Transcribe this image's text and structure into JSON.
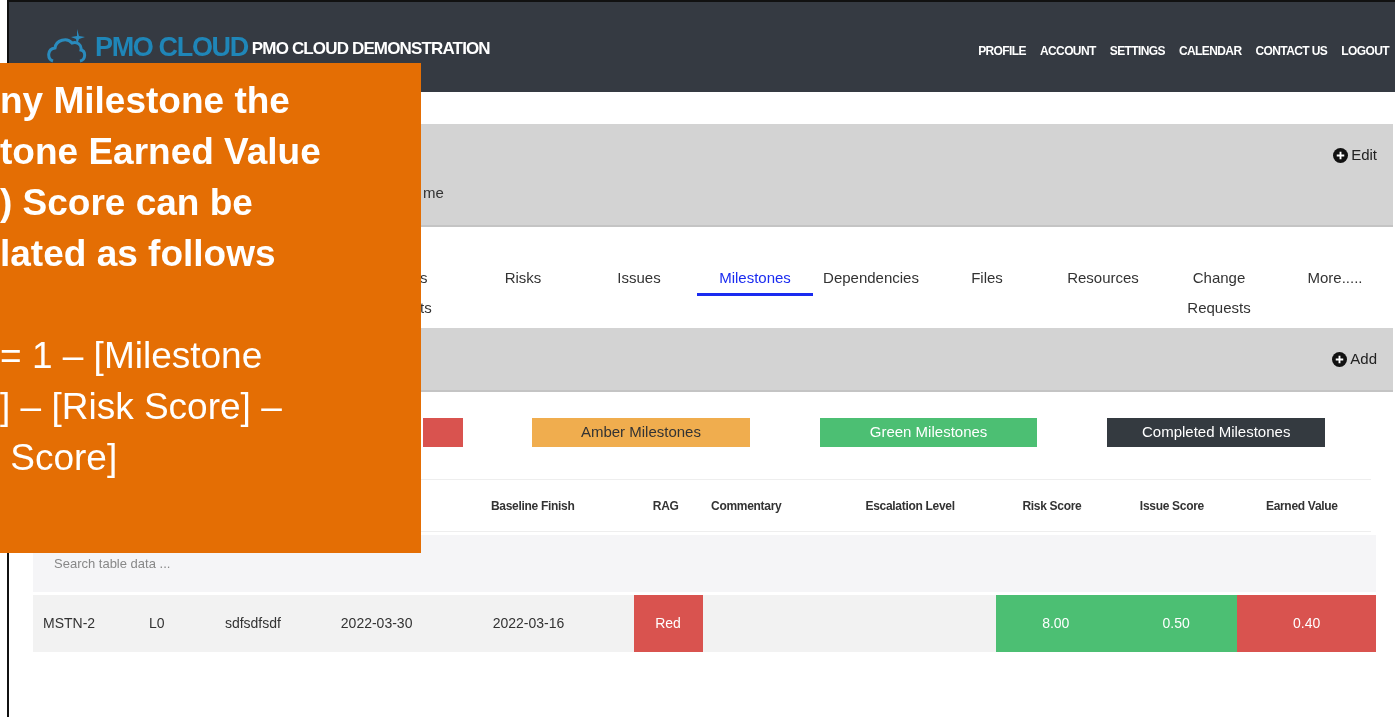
{
  "header": {
    "logo": "PMO CLOUD",
    "title": "PMO CLOUD DEMONSTRATION",
    "nav": [
      "PROFILE",
      "ACCOUNT",
      "SETTINGS",
      "CALENDAR",
      "CONTACT US",
      "LOGOUT"
    ]
  },
  "project_panel": {
    "fragment": "me",
    "action": "Edit"
  },
  "tabs": [
    {
      "label": "s\nts",
      "selected": false
    },
    {
      "label": "Risks",
      "selected": false
    },
    {
      "label": "Issues",
      "selected": false
    },
    {
      "label": "Milestones",
      "selected": true
    },
    {
      "label": "Dependencies",
      "selected": false
    },
    {
      "label": "Files",
      "selected": false
    },
    {
      "label": "Resources",
      "selected": false
    },
    {
      "label": "Change\nRequests",
      "selected": false
    },
    {
      "label": "More.....",
      "selected": false
    }
  ],
  "milestones_panel": {
    "action": "Add"
  },
  "filters": [
    {
      "color": "#d9534f"
    },
    {
      "label": "Amber Milestones",
      "color": "#f0ad4e"
    },
    {
      "label": "Green Milestones",
      "color": "#4cbf73"
    },
    {
      "label": "Completed Milestones",
      "color": "#343a40"
    }
  ],
  "table": {
    "columns": [
      "",
      "",
      "",
      "",
      "Baseline Finish",
      "RAG",
      "Commentary",
      "Escalation Level",
      "Risk Score",
      "Issue Score",
      "Earned Value"
    ],
    "search": {
      "placeholder": "Search table data ..."
    },
    "rows": [
      {
        "cells": [
          {
            "text": "MSTN-2"
          },
          {
            "text": "L0"
          },
          {
            "text": "sdfsdfsdf"
          },
          {
            "text": "2022-03-30"
          },
          {
            "text": "2022-03-16"
          },
          {
            "text": "Red",
            "color": "#d9534f"
          },
          {},
          {},
          {
            "text": "8.00",
            "color": "#4cbf73"
          },
          {
            "text": "0.50",
            "color": "#4cbf73"
          },
          {
            "text": "0.40",
            "color": "#d9534f"
          }
        ]
      }
    ]
  },
  "callout": {
    "heading": "ny Milestone the\ntone Earned Value\n) Score can be\nlated as follows",
    "formula": "= 1 – [Milestone\n] – [Risk Score] –\n Score]"
  }
}
